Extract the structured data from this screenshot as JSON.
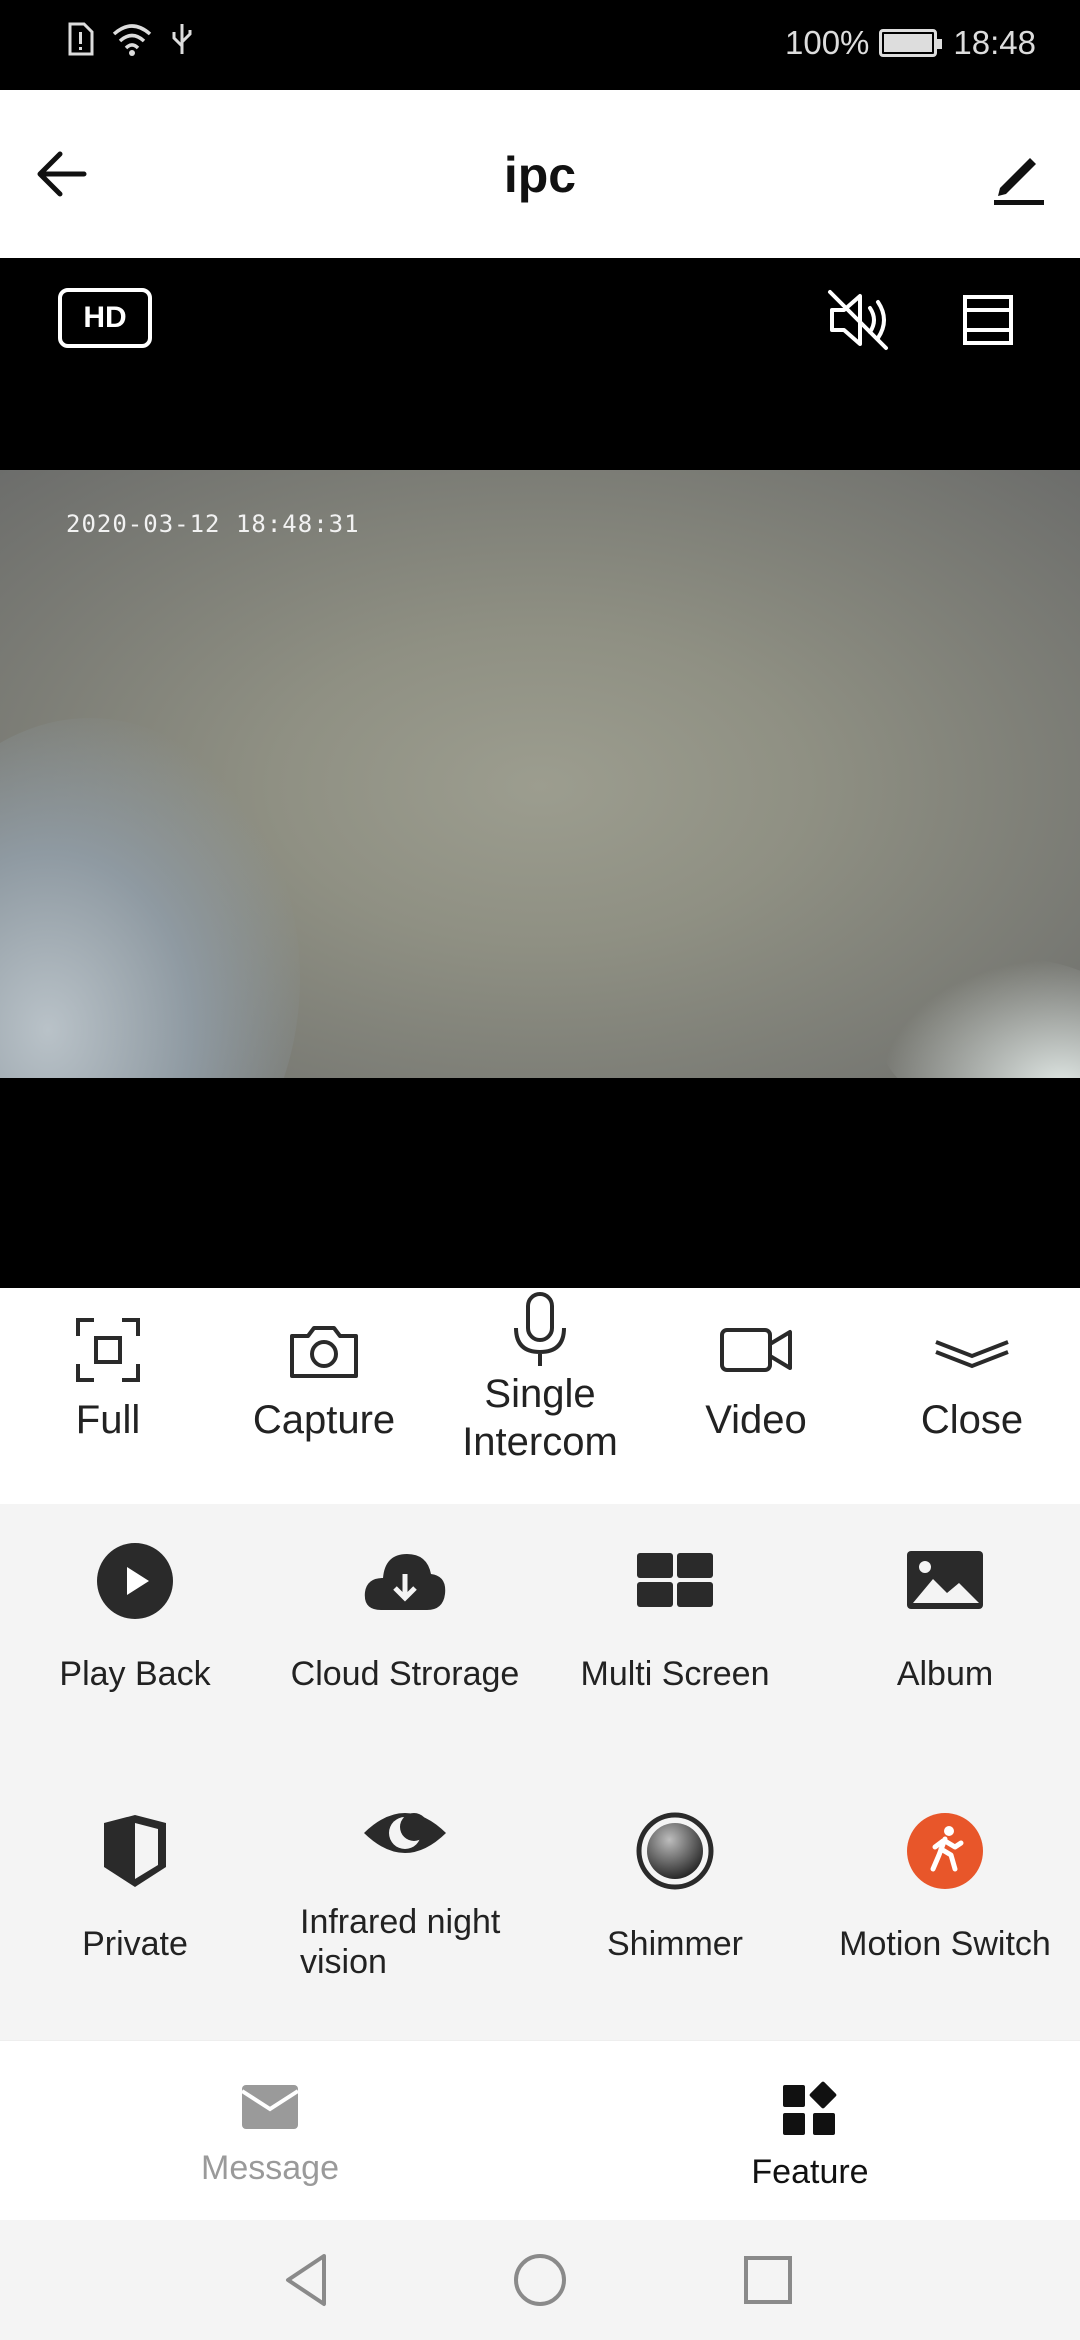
{
  "status_bar": {
    "battery": "100%",
    "time": "18:48"
  },
  "header": {
    "title": "ipc"
  },
  "video": {
    "quality_badge": "HD",
    "timestamp": "2020-03-12 18:48:31"
  },
  "controls": [
    {
      "label": "Full",
      "icon": "fullscreen-icon"
    },
    {
      "label": "Capture",
      "icon": "camera-icon"
    },
    {
      "label": "Single\nIntercom",
      "icon": "microphone-icon"
    },
    {
      "label": "Video",
      "icon": "video-camera-icon"
    },
    {
      "label": "Close",
      "icon": "chevron-double-down-icon"
    }
  ],
  "features": [
    {
      "label": "Play Back",
      "icon": "play-circle-icon"
    },
    {
      "label": "Cloud Strorage",
      "icon": "cloud-download-icon"
    },
    {
      "label": "Multi Screen",
      "icon": "grid-icon"
    },
    {
      "label": "Album",
      "icon": "image-icon"
    },
    {
      "label": "Private",
      "icon": "shield-icon"
    },
    {
      "label": "Infrared night vision",
      "icon": "eye-moon-icon"
    },
    {
      "label": "Shimmer",
      "icon": "shimmer-circle-icon"
    },
    {
      "label": "Motion Switch",
      "icon": "walking-person-icon"
    }
  ],
  "tabs": [
    {
      "label": "Message",
      "icon": "envelope-icon",
      "active": false
    },
    {
      "label": "Feature",
      "icon": "feature-grid-icon",
      "active": true
    }
  ],
  "colors": {
    "accent_orange": "#e8562a",
    "text_dark": "#222222",
    "tab_inactive": "#9a9a9a",
    "icon_dark": "#2a2a2a"
  }
}
